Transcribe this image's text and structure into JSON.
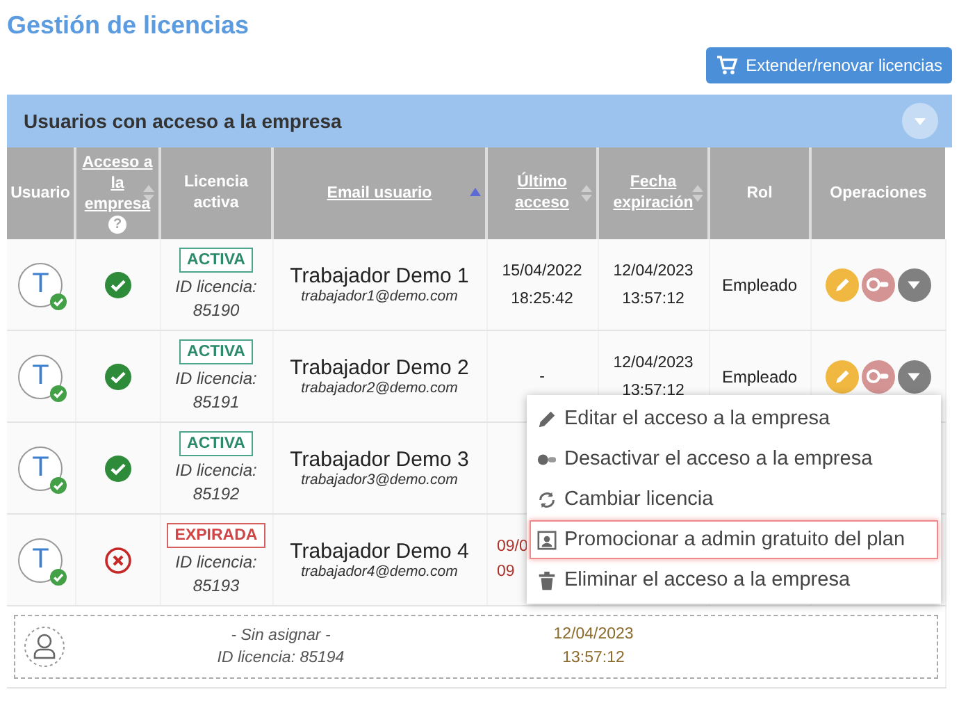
{
  "page": {
    "title": "Gestión de licencias",
    "action_button": "Extender/renovar licencias"
  },
  "panel": {
    "title": "Usuarios con acceso a la empresa"
  },
  "table": {
    "columns": [
      {
        "label": "Usuario",
        "sortable": false
      },
      {
        "label": "Acceso a la empresa",
        "sortable": true,
        "sorted": false,
        "help": "?"
      },
      {
        "label": "Licencia activa",
        "sortable": false
      },
      {
        "label": "Email usuario",
        "sortable": true,
        "sorted": true
      },
      {
        "label": "Último acceso",
        "sortable": true,
        "sorted": false
      },
      {
        "label": "Fecha expiración",
        "sortable": true,
        "sorted": false
      },
      {
        "label": "Rol",
        "sortable": false
      },
      {
        "label": "Operaciones",
        "sortable": false
      }
    ],
    "rows": [
      {
        "avatar": "T",
        "access": true,
        "license": {
          "status": "ACTIVA",
          "kind": "active"
        },
        "license_id": [
          "ID licencia:",
          "85190"
        ],
        "name": "Trabajador Demo 1",
        "email": "trabajador1@demo.com",
        "last_access": [
          "15/04/2022",
          "18:25:42"
        ],
        "expiration": [
          "12/04/2023",
          "13:57:12"
        ],
        "role": "Empleado",
        "operations": [
          {
            "kind": "edit"
          },
          {
            "kind": "deactivate"
          },
          {
            "kind": "more"
          }
        ]
      },
      {
        "avatar": "T",
        "access": true,
        "license": {
          "status": "ACTIVA",
          "kind": "active"
        },
        "license_id": [
          "ID licencia:",
          "85191"
        ],
        "name": "Trabajador Demo 2",
        "email": "trabajador2@demo.com",
        "last_access": [
          "-"
        ],
        "expiration": [
          "12/04/2023",
          "13:57:12"
        ],
        "role": "Empleado",
        "operations": [
          {
            "kind": "edit"
          },
          {
            "kind": "deactivate"
          },
          {
            "kind": "more"
          }
        ]
      },
      {
        "avatar": "T",
        "access": true,
        "license": {
          "status": "ACTIVA",
          "kind": "active"
        },
        "license_id": [
          "ID licencia:",
          "85192"
        ],
        "name": "Trabajador Demo 3",
        "email": "trabajador3@demo.com"
      },
      {
        "avatar": "T",
        "access": false,
        "license": {
          "status": "EXPIRADA",
          "kind": "expired"
        },
        "license_id": [
          "ID licencia:",
          "85193"
        ],
        "name": "Trabajador Demo 4",
        "email": "trabajador4@demo.com",
        "last_access": [
          "09/0",
          "09"
        ]
      }
    ],
    "unassigned": {
      "label": "- Sin asignar -",
      "license_id": "ID licencia: 85194",
      "expiration": [
        "12/04/2023",
        "13:57:12"
      ]
    }
  },
  "menu": {
    "items": [
      {
        "kind": "edit",
        "label": "Editar el acceso a la empresa",
        "selected": false
      },
      {
        "kind": "deactivate",
        "label": "Desactivar el acceso a la empresa",
        "selected": false
      },
      {
        "kind": "change",
        "label": "Cambiar licencia",
        "selected": false
      },
      {
        "kind": "promote",
        "label": "Promocionar a admin gratuito del plan",
        "selected": true
      },
      {
        "kind": "delete",
        "label": "Eliminar el acceso a la empresa",
        "selected": false
      }
    ]
  }
}
